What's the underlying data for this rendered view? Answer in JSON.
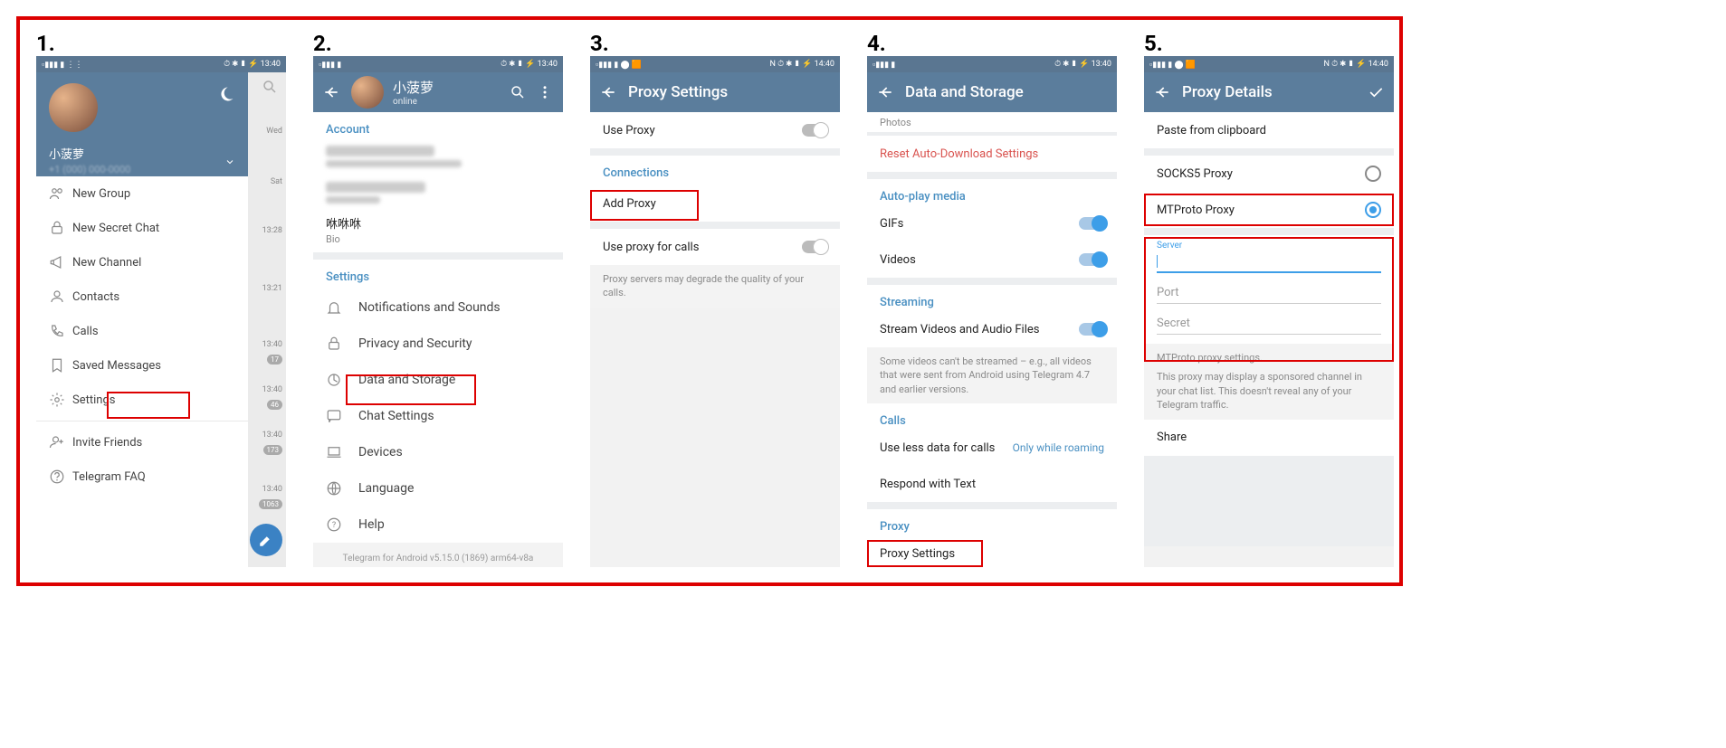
{
  "steps": {
    "s1": "1.",
    "s2": "2.",
    "s3": "3.",
    "s4": "4.",
    "s5": "5."
  },
  "status_time_1340": "13:40",
  "status_time_1440": "14:40",
  "screen1": {
    "user_name": "小菠萝",
    "phone_blur": "+1 (000) 000-0000",
    "menu": {
      "new_group": "New Group",
      "new_secret": "New Secret Chat",
      "new_channel": "New Channel",
      "contacts": "Contacts",
      "calls": "Calls",
      "saved": "Saved Messages",
      "settings": "Settings",
      "invite": "Invite Friends",
      "faq": "Telegram FAQ"
    },
    "chat_hints": {
      "wed": "Wed",
      "sat": "Sat",
      "t1": "13:28",
      "t2": "13:21",
      "t3": "13:40",
      "b1": "17",
      "t4": "13:40",
      "b2": "46",
      "t5": "13:40",
      "b3": "173",
      "t6": "13:40",
      "b4": "1063"
    }
  },
  "screen2": {
    "title": "小菠萝",
    "subtitle": "online",
    "account_hdr": "Account",
    "bio_name": "咻咻咻",
    "bio_label": "Bio",
    "settings_hdr": "Settings",
    "items": {
      "notifications": "Notifications and Sounds",
      "privacy": "Privacy and Security",
      "data": "Data and Storage",
      "chat": "Chat Settings",
      "devices": "Devices",
      "language": "Language",
      "help": "Help"
    },
    "footer": "Telegram for Android v5.15.0 (1869) arm64-v8a"
  },
  "screen3": {
    "title": "Proxy Settings",
    "use_proxy": "Use Proxy",
    "connections": "Connections",
    "add_proxy": "Add Proxy",
    "use_calls": "Use proxy for calls",
    "note": "Proxy servers may degrade the quality of your calls."
  },
  "screen4": {
    "title": "Data and Storage",
    "photos": "Photos",
    "reset": "Reset Auto-Download Settings",
    "autoplay_hdr": "Auto-play media",
    "gifs": "GIFs",
    "videos": "Videos",
    "streaming_hdr": "Streaming",
    "stream": "Stream Videos and Audio Files",
    "stream_note": "Some videos can't be streamed – e.g., all videos that were sent from Android using Telegram 4.7 and earlier versions.",
    "calls_hdr": "Calls",
    "less_data": "Use less data for calls",
    "less_data_val": "Only while roaming",
    "respond": "Respond with Text",
    "proxy_hdr": "Proxy",
    "proxy_settings": "Proxy Settings"
  },
  "screen5": {
    "title": "Proxy Details",
    "paste": "Paste from clipboard",
    "socks": "SOCKS5 Proxy",
    "mtproto": "MTProto Proxy",
    "server_lbl": "Server",
    "port_lbl": "Port",
    "secret_lbl": "Secret",
    "note_hdr": "MTProto proxy settings.",
    "note_body": "This proxy may display a sponsored channel in your chat list. This doesn't reveal any of your Telegram traffic.",
    "share": "Share"
  }
}
